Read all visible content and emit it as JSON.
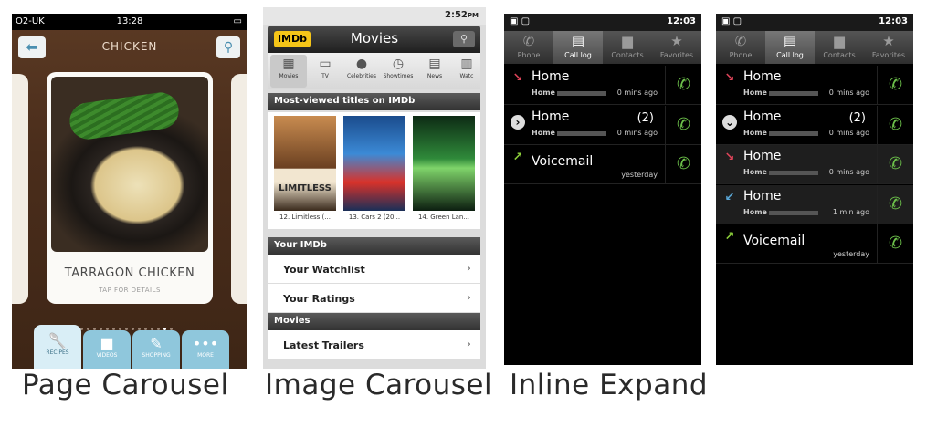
{
  "captions": {
    "page_carousel": "Page Carousel",
    "image_carousel": "Image Carousel",
    "inline_expand": "Inline Expand"
  },
  "page_carousel": {
    "status": {
      "carrier": "O2-UK",
      "time": "13:28"
    },
    "title": "CHICKEN",
    "card": {
      "name": "TARRAGON CHICKEN",
      "hint": "TAP FOR DETAILS"
    },
    "page_dots": {
      "count": 16,
      "active_index": 14
    },
    "tabs": [
      {
        "label": "RECIPES",
        "icon": "spoon-icon",
        "active": true
      },
      {
        "label": "VIDEOS",
        "icon": "video-camera-icon",
        "active": false
      },
      {
        "label": "SHOPPING",
        "icon": "pencil-icon",
        "active": false
      },
      {
        "label": "MORE",
        "icon": "more-dots-icon",
        "active": false
      }
    ]
  },
  "image_carousel": {
    "status": {
      "time": "2:52",
      "ampm": "PM"
    },
    "app_title": "Movies",
    "logo": "IMDb",
    "categories": [
      "Movies",
      "TV",
      "Celebrities",
      "Showtimes",
      "News",
      "Watc"
    ],
    "most_viewed_header": "Most-viewed titles on IMDb",
    "posters": [
      {
        "label": "12. Limitless (...",
        "poster_text": "LIMITLESS",
        "color": "#b27a4a"
      },
      {
        "label": "13. Cars 2 (20...",
        "poster_text": "",
        "color": "#2a6fb8"
      },
      {
        "label": "14. Green Lan...",
        "poster_text": "",
        "color": "#2f8a3a"
      }
    ],
    "your_imdb_header": "Your IMDb",
    "your_imdb_items": [
      "Your Watchlist",
      "Your Ratings"
    ],
    "movies_header": "Movies",
    "movies_items": [
      "Latest Trailers"
    ]
  },
  "call_log_tabs": [
    "Phone",
    "Call log",
    "Contacts",
    "Favorites"
  ],
  "call_log_collapsed": {
    "status_time": "12:03",
    "entries": [
      {
        "name": "Home",
        "type": "Home",
        "when": "0 mins ago",
        "count": "",
        "kind": "missed"
      },
      {
        "name": "Home",
        "type": "Home",
        "when": "0 mins ago",
        "count": "(2)",
        "kind": "expand"
      },
      {
        "name": "Voicemail",
        "type": "",
        "when": "yesterday",
        "count": "",
        "kind": "outgoing"
      }
    ]
  },
  "call_log_expanded": {
    "status_time": "12:03",
    "entries": [
      {
        "name": "Home",
        "type": "Home",
        "when": "0 mins ago",
        "count": "",
        "kind": "missed"
      },
      {
        "name": "Home",
        "type": "Home",
        "when": "0 mins ago",
        "count": "(2)",
        "kind": "collapse"
      },
      {
        "name": "Home",
        "type": "Home",
        "when": "0 mins ago",
        "count": "",
        "kind": "missed"
      },
      {
        "name": "Home",
        "type": "Home",
        "when": "1 min ago",
        "count": "",
        "kind": "incoming"
      },
      {
        "name": "Voicemail",
        "type": "",
        "when": "yesterday",
        "count": "",
        "kind": "outgoing"
      }
    ]
  },
  "colors": {
    "accent_blue": "#8fc7dc",
    "imdb_yellow": "#f5c518",
    "call_green": "#6cc04a",
    "missed_red": "#e0455a",
    "incoming_blue": "#5aa8d8",
    "outgoing_green": "#8ccf3a"
  }
}
